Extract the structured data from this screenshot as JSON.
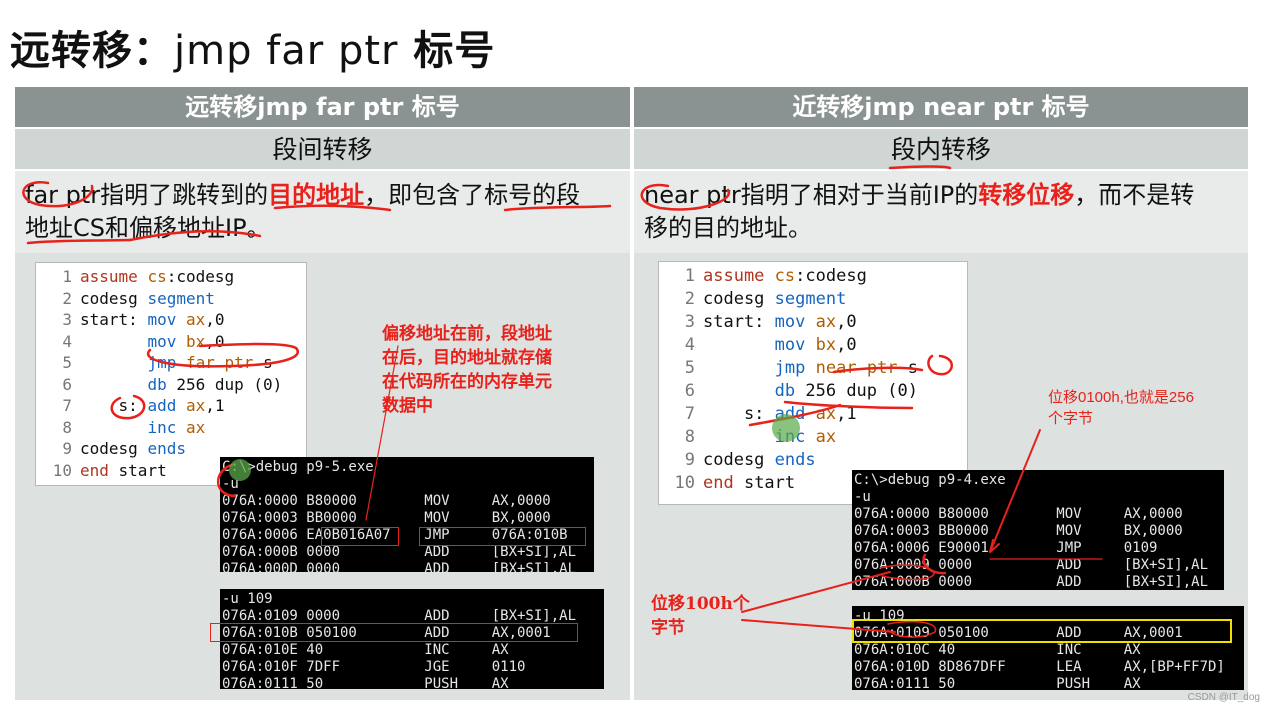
{
  "slide_title": {
    "part1": "远转移：",
    "part2": "jmp far ptr",
    "part3": " 标号"
  },
  "left": {
    "header": "远转移jmp far ptr 标号",
    "sub": "段间转移",
    "desc": {
      "a": "far ptr",
      "b": "指明了跳转到的",
      "c": "目的地址",
      "d": "，即包含了标号的段",
      "e": "地址CS和偏移地址IP。"
    },
    "code_lines": [
      {
        "n": "1",
        "t": "assume cs:codesg"
      },
      {
        "n": "2",
        "t": "codesg segment"
      },
      {
        "n": "3",
        "t": "start: mov ax,0"
      },
      {
        "n": "4",
        "t": "       mov bx,0"
      },
      {
        "n": "5",
        "t": "       jmp far ptr s"
      },
      {
        "n": "6",
        "t": "       db 256 dup (0)"
      },
      {
        "n": "7",
        "t": "    s: add ax,1"
      },
      {
        "n": "8",
        "t": "       inc ax"
      },
      {
        "n": "9",
        "t": "codesg ends"
      },
      {
        "n": "10",
        "t": "end start"
      }
    ],
    "note": "偏移地址在前，段地址在后，目的地址就存储在代码所在的内存单元数据中",
    "console1": [
      "C:\\>debug p9-5.exe",
      "-u",
      "076A:0000 B80000        MOV     AX,0000",
      "076A:0003 BB0000        MOV     BX,0000",
      "076A:0006 EA0B016A07    JMP     076A:010B",
      "076A:000B 0000          ADD     [BX+SI],AL",
      "076A:000D 0000          ADD     [BX+SI],AL"
    ],
    "console2": [
      "-u 109",
      "076A:0109 0000          ADD     [BX+SI],AL",
      "076A:010B 050100        ADD     AX,0001",
      "076A:010E 40            INC     AX",
      "076A:010F 7DFF          JGE     0110",
      "076A:0111 50            PUSH    AX"
    ]
  },
  "right": {
    "header": "近转移jmp near ptr 标号",
    "sub": "段内转移",
    "desc": {
      "a": "near ptr",
      "b": "指明了相对于当前IP的",
      "c": "转移位移",
      "d": "，而不是转",
      "e": "移的目的地址。"
    },
    "code_lines": [
      {
        "n": "1",
        "t": "assume cs:codesg"
      },
      {
        "n": "2",
        "t": "codesg segment"
      },
      {
        "n": "3",
        "t": "start: mov ax,0"
      },
      {
        "n": "4",
        "t": "       mov bx,0"
      },
      {
        "n": "5",
        "t": "       jmp near ptr s"
      },
      {
        "n": "6",
        "t": "       db 256 dup (0)"
      },
      {
        "n": "7",
        "t": "    s: add ax,1"
      },
      {
        "n": "8",
        "t": "       inc ax"
      },
      {
        "n": "9",
        "t": "codesg ends"
      },
      {
        "n": "10",
        "t": "end start"
      }
    ],
    "note1": "位移0100h,也就是256个字节",
    "note2": "位移100h个字节",
    "console1": [
      "C:\\>debug p9-4.exe",
      "-u",
      "076A:0000 B80000        MOV     AX,0000",
      "076A:0003 BB0000        MOV     BX,0000",
      "076A:0006 E90001        JMP     0109",
      "076A:0009 0000          ADD     [BX+SI],AL",
      "076A:000B 0000          ADD     [BX+SI],AL"
    ],
    "console2": [
      "-u 109",
      "076A:0109 050100        ADD     AX,0001",
      "076A:010C 40            INC     AX",
      "076A:010D 8D867DFF      LEA     AX,[BP+FF7D]",
      "076A:0111 50            PUSH    AX"
    ]
  },
  "watermark": "CSDN @IT_dog"
}
